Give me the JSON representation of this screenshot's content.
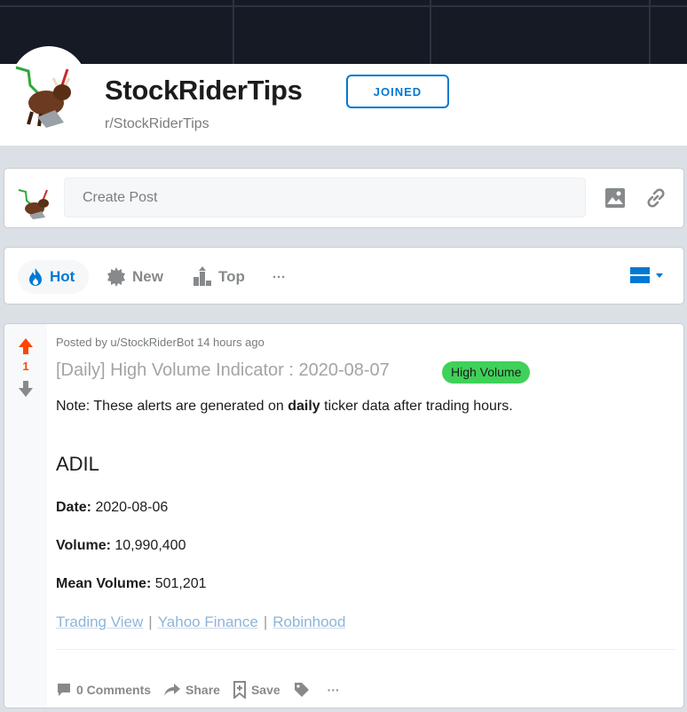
{
  "community": {
    "name": "StockRiderTips",
    "handle": "r/StockRiderTips",
    "join_label": "JOINED"
  },
  "create_post": {
    "placeholder": "Create Post"
  },
  "sort": {
    "items": [
      {
        "label": "Hot",
        "icon": "flame-icon",
        "active": true
      },
      {
        "label": "New",
        "icon": "starburst-icon",
        "active": false
      },
      {
        "label": "Top",
        "icon": "bar-chart-icon",
        "active": false
      }
    ],
    "more": "···"
  },
  "post": {
    "votes": "1",
    "posted_by": "Posted by u/StockRiderBot 14 hours ago",
    "title": "[Daily] High Volume Indicator : 2020-08-07",
    "flair": "High Volume",
    "note_prefix": "Note: These alerts are generated on ",
    "note_bold": "daily",
    "note_suffix": " ticker data after trading hours.",
    "ticker": "ADIL",
    "fields": [
      {
        "label": "Date:",
        "value": " 2020-08-06"
      },
      {
        "label": "Volume:",
        "value": " 10,990,400"
      },
      {
        "label": "Mean Volume:",
        "value": " 501,201"
      }
    ],
    "links": [
      "Trading View",
      "Yahoo Finance",
      "Robinhood"
    ],
    "link_separator": "|",
    "actions": {
      "comments": "0 Comments",
      "share": "Share",
      "save": "Save",
      "more": "···"
    }
  },
  "colors": {
    "accent": "#0079d3",
    "upvote": "#ff4500",
    "flair": "#3fd159",
    "banner": "#161a25"
  }
}
